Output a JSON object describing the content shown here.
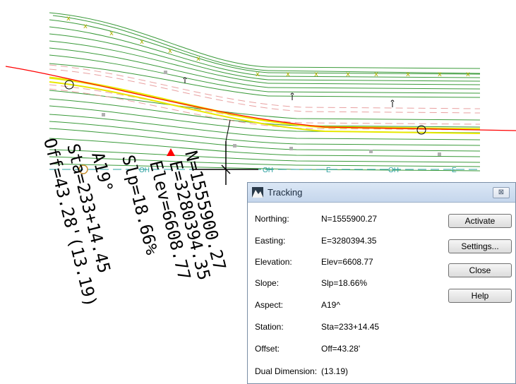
{
  "drawing_labels": {
    "northing": "N=1555900.27",
    "easting": "E=3280394.35",
    "elevation": "Elev=6608.77",
    "slope": "Slp=18.66%",
    "aspect": "A19°",
    "station": "Sta=233+14.45",
    "offset": "Off=43.28'(13.19)"
  },
  "utility_labels": {
    "oh": "OH",
    "e": "E"
  },
  "dialog": {
    "title": "Tracking",
    "close_glyph": "⊠",
    "fields": [
      {
        "label": "Northing:",
        "value": "N=1555900.27"
      },
      {
        "label": "Easting:",
        "value": "E=3280394.35"
      },
      {
        "label": "Elevation:",
        "value": "Elev=6608.77"
      },
      {
        "label": "Slope:",
        "value": "Slp=18.66%"
      },
      {
        "label": "Aspect:",
        "value": "A19^"
      },
      {
        "label": "Station:",
        "value": "Sta=233+14.45"
      },
      {
        "label": "Offset:",
        "value": "Off=43.28'"
      },
      {
        "label": "Dual Dimension:",
        "value": "(13.19)"
      }
    ],
    "buttons": {
      "activate": "Activate",
      "settings": "Settings...",
      "close": "Close",
      "help": "Help"
    }
  },
  "colors": {
    "contour": "#3a9a3a",
    "alignment": "#ff0000",
    "edge": "#e8e800",
    "fence_marker": "#b0b000",
    "utility": "#2aa0a0"
  }
}
